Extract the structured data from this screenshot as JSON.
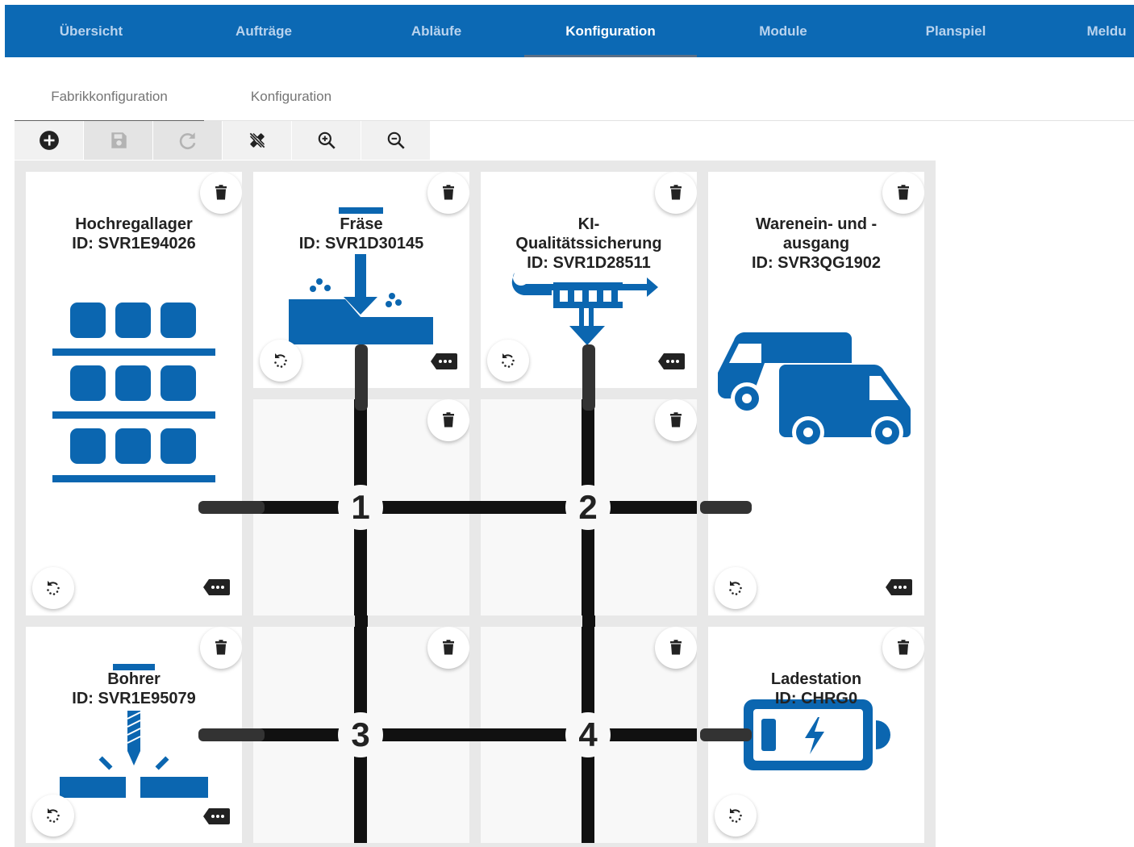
{
  "nav": {
    "items": [
      "Übersicht",
      "Aufträge",
      "Abläufe",
      "Konfiguration",
      "Module",
      "Planspiel",
      "Meldu"
    ],
    "active": "Konfiguration"
  },
  "subtabs": {
    "items": [
      "Fabrikkonfiguration",
      "Konfiguration"
    ],
    "active": "Fabrikkonfiguration"
  },
  "toolbar": {
    "buttons": [
      {
        "icon": "add-circle-icon",
        "enabled": true
      },
      {
        "icon": "save-icon",
        "enabled": false
      },
      {
        "icon": "redo-icon",
        "enabled": false
      },
      {
        "icon": "clear-grid-icon",
        "enabled": true
      },
      {
        "icon": "zoom-in-icon",
        "enabled": true
      },
      {
        "icon": "zoom-out-icon",
        "enabled": true
      }
    ]
  },
  "colors": {
    "brand": "#0c69b4",
    "module_blue": "#0b66b0",
    "track": "#111111"
  },
  "modules": {
    "hochregallager": {
      "name": "Hochregallager",
      "id": "ID: SVR1E94026"
    },
    "fraese": {
      "name": "Fräse",
      "id": "ID: SVR1D30145"
    },
    "ki": {
      "name_line1": "KI-",
      "name_line2": "Qualitätssicherung",
      "id": "ID: SVR1D28511"
    },
    "warenausgang": {
      "name_line1": "Warenein- und -",
      "name_line2": "ausgang",
      "id": "ID: SVR3QG1902"
    },
    "bohrer": {
      "name": "Bohrer",
      "id": "ID: SVR1E95079"
    },
    "ladestation": {
      "name": "Ladestation",
      "id": "ID: CHRG0"
    }
  },
  "roads": {
    "labels": [
      "1",
      "2",
      "3",
      "4"
    ]
  }
}
